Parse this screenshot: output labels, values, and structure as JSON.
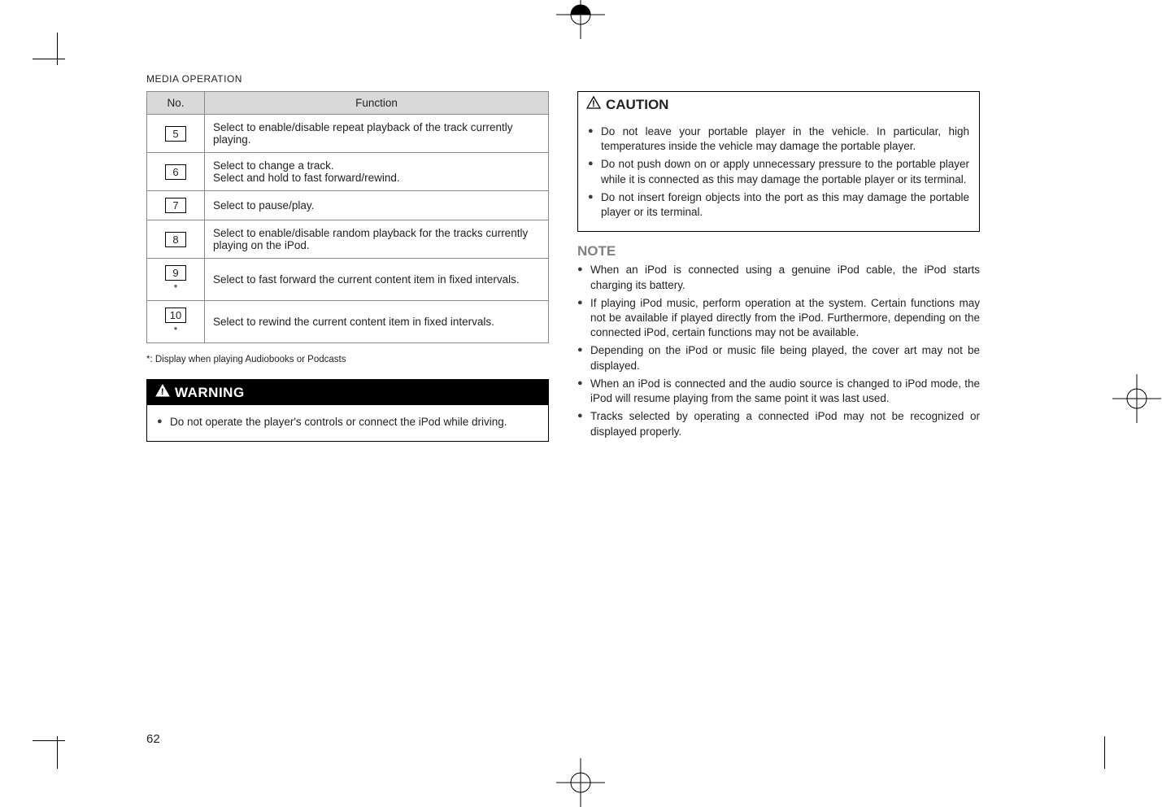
{
  "section_header": "MEDIA OPERATION",
  "table": {
    "headers": {
      "no": "No.",
      "fn": "Function"
    },
    "rows": [
      {
        "num": "5",
        "star": "",
        "text": "Select to enable/disable repeat playback of the track currently playing."
      },
      {
        "num": "6",
        "star": "",
        "text": "Select to change a track.\nSelect and hold to fast forward/rewind."
      },
      {
        "num": "7",
        "star": "",
        "text": "Select to pause/play."
      },
      {
        "num": "8",
        "star": "",
        "text": "Select to enable/disable random playback for the tracks currently playing on the iPod."
      },
      {
        "num": "9",
        "star": "*",
        "text": "Select to fast forward the current content item in fixed intervals."
      },
      {
        "num": "10",
        "star": "*",
        "text": "Select to rewind the current content item in fixed intervals."
      }
    ]
  },
  "footnote": "*:   Display when playing Audiobooks or Podcasts",
  "warning": {
    "title": "WARNING",
    "items": [
      "Do not operate the player's controls or connect the iPod while driving."
    ]
  },
  "caution": {
    "title": "CAUTION",
    "items": [
      "Do not leave your portable player in the vehicle. In particular, high temperatures inside the vehicle may damage the portable player.",
      "Do not push down on or apply unnecessary pressure to the portable player while it is connected as this may damage the portable player or its terminal.",
      "Do not insert foreign objects into the port as this may damage the portable player or its terminal."
    ]
  },
  "note": {
    "title": "NOTE",
    "items": [
      "When an iPod is connected using a genuine iPod cable, the iPod starts charging its battery.",
      "If playing iPod music, perform operation at the system. Certain functions may not be available if played directly from the iPod. Furthermore, depending on the connected iPod, certain functions may not be available.",
      "Depending on the iPod or music file being played, the cover art may not be displayed.",
      "When an iPod is connected and the audio source is changed to iPod mode, the iPod will resume playing from the same point it was last used.",
      "Tracks selected by operating a connected iPod may not be recognized or displayed properly."
    ]
  },
  "page_number": "62"
}
